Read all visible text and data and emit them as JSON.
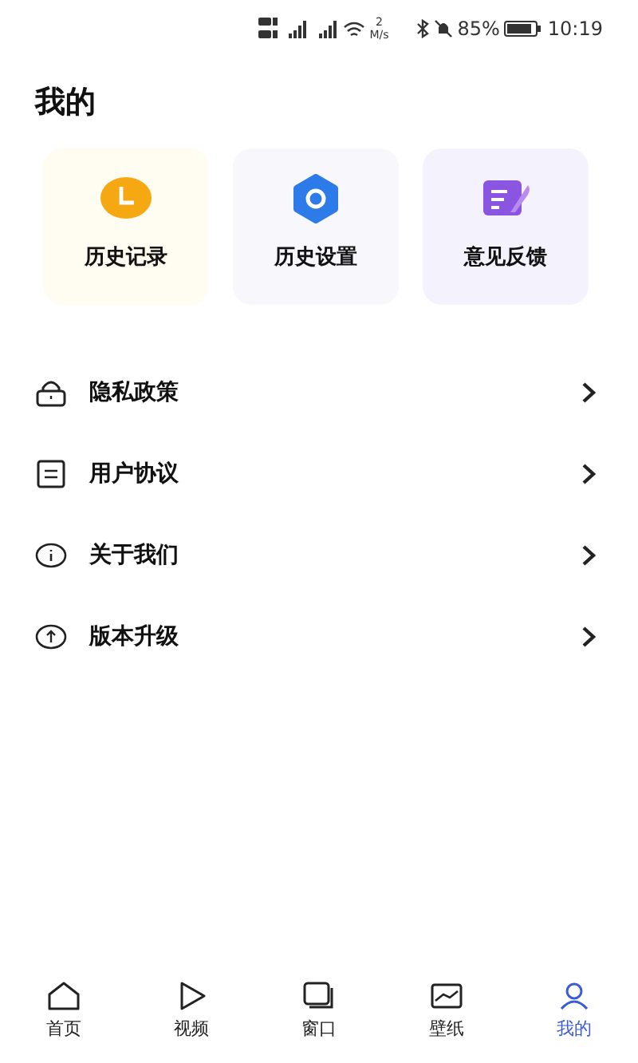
{
  "status_bar": {
    "speed_value": "2",
    "speed_unit": "M/s",
    "battery": "85%",
    "time": "10:19"
  },
  "title": "我的",
  "cards": [
    {
      "kind": "clock",
      "label": "历史记录"
    },
    {
      "kind": "gear",
      "label": "历史设置"
    },
    {
      "kind": "note",
      "label": "意见反馈"
    }
  ],
  "menu": [
    {
      "kind": "lock",
      "label": "隐私政策"
    },
    {
      "kind": "doc",
      "label": "用户协议"
    },
    {
      "kind": "info",
      "label": "关于我们"
    },
    {
      "kind": "upgrade",
      "label": "版本升级"
    }
  ],
  "tabs": [
    {
      "kind": "home",
      "label": "首页",
      "selected": false
    },
    {
      "kind": "video",
      "label": "视频",
      "selected": false
    },
    {
      "kind": "window",
      "label": "窗口",
      "selected": false
    },
    {
      "kind": "wallpaper",
      "label": "壁纸",
      "selected": false
    },
    {
      "kind": "me",
      "label": "我的",
      "selected": true
    }
  ]
}
